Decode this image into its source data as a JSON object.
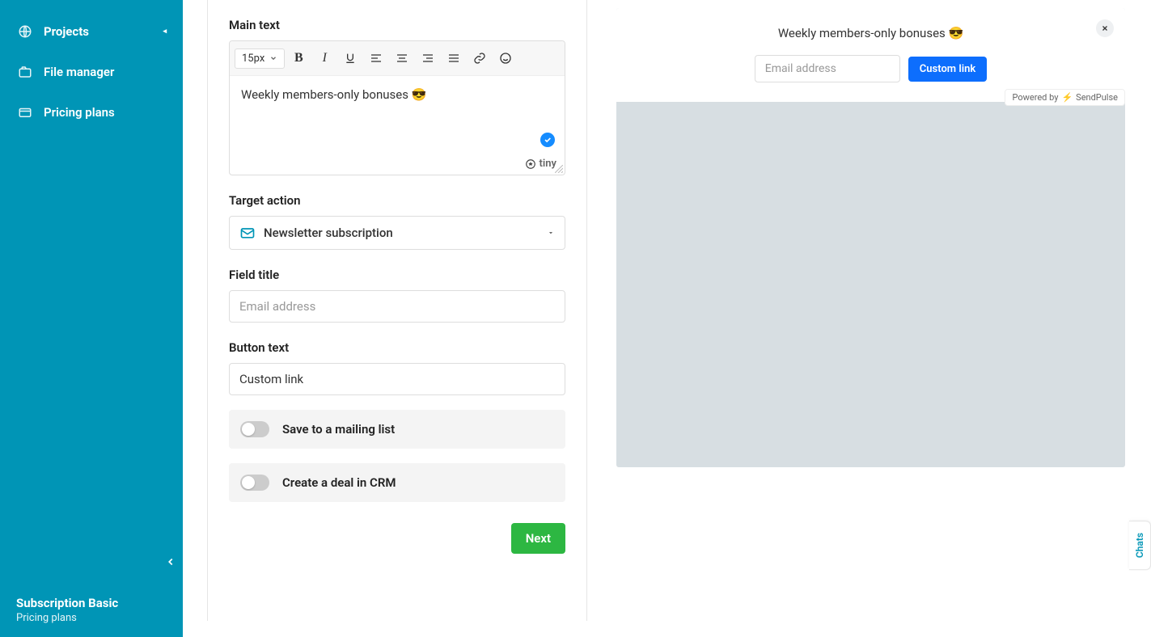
{
  "sidebar": {
    "items": [
      {
        "label": "Projects"
      },
      {
        "label": "File manager"
      },
      {
        "label": "Pricing plans"
      }
    ],
    "subscription_title": "Subscription Basic",
    "subscription_link": "Pricing plans"
  },
  "editor": {
    "main_text_label": "Main text",
    "font_size": "15px",
    "main_text_value": "Weekly members-only bonuses 😎",
    "tiny_brand": "tiny",
    "target_action_label": "Target action",
    "target_action_value": "Newsletter subscription",
    "field_title_label": "Field title",
    "field_title_placeholder": "Email address",
    "button_text_label": "Button text",
    "button_text_value": "Custom link",
    "toggle_mailing_label": "Save to a mailing list",
    "toggle_crm_label": "Create a deal in CRM",
    "next_label": "Next"
  },
  "preview": {
    "title": "Weekly members-only bonuses 😎",
    "input_placeholder": "Email address",
    "button_label": "Custom link",
    "powered_prefix": "Powered by",
    "powered_brand": "SendPulse"
  },
  "chats_label": "Chats"
}
